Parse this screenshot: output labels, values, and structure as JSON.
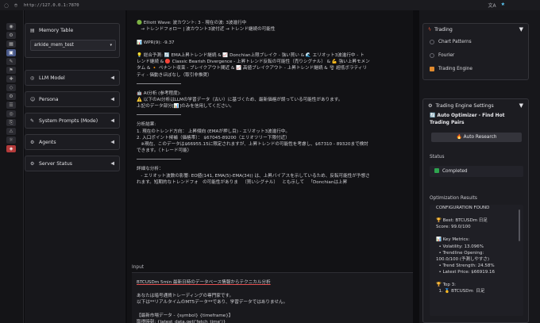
{
  "browser": {
    "url": "http://127.0.0.1:7870",
    "translate_icon": "文A",
    "star_icon": "★"
  },
  "nav_icons": [
    "◉",
    "⚙",
    "▦",
    "▣",
    "✎",
    "⚑",
    "✚",
    "◇",
    "⚙",
    "☰",
    "◎",
    "⎘",
    "⚠",
    "☼",
    "◈"
  ],
  "sidebar": {
    "memory_table": {
      "label": "Memory Table",
      "value": "arkide_mem_test"
    },
    "panels": [
      {
        "label": "LLM Model"
      },
      {
        "label": "Persona"
      },
      {
        "label": "System Prompts (Mode)"
      },
      {
        "label": "Agents"
      },
      {
        "label": "Server Status"
      }
    ]
  },
  "output": {
    "lines": [
      "🟢 Elliott Wave: 波カウント: 3 - 現在の波: 3波進行中",
      "   → トレンドフォロー | 波カウント3波付近 → トレンド継続の可能性",
      "",
      "📊 WPR(9): -9.37",
      "",
      "💡 総合予測: 🔄 EMA上昇トレンド継続 & 📈 Donchian上限ブレイク - 強い買い & 🌊 エリオット3波進行中 - ト",
      "レンド継続 & 🔴 Classic Bearish Divergence - 上昇トレンド反転の可能性（売りシグナル） & 💪 強い上昇モメン",
      "タム & 🔸 ペナント収束 - ブレイクアウト間近 & 📈 高値ブレイクアウト - 上昇トレンド継続 & 🌪 超低ボラティリ",
      "ティ - 価動きほぼなし（取引非推奨）"
    ],
    "ai_lines": [
      "🤖 AI分析 (参考程度):",
      "⚠️ 以下のAI分析はLLMの学習データ（古い）に基づくため、最新価格が誤っている可能性があります。",
      "上記のデータ部分[📊]のみを信用してください。"
    ],
    "analysis_lines": [
      "分析結果:",
      "1. 現在のトレンド方向： 上昇傾向 (EMAが押し目) - エリオット3波進行中。",
      "2. 入口ポイント候補（価格帯）： $67045-89200（エリオツリー下限付近）",
      "   ※現在、このデータは$66955.15に限定されますが、上昇トレンドの可能性を考慮し、$67310 - 89320まで検討",
      "できます。（トレード可能）"
    ],
    "detail_lines": [
      "詳細な分析：",
      "   - エリオット波数の影響: EO値(141, EMA(5)-EMA(34)) は、上昇バイアスを示しているため、反転可能性が予想さ",
      "れます。短期的なトレンドフォ   の可能性がありま   （買いシグナル）   とも示して   「Donchianは上昇"
    ]
  },
  "input": {
    "label": "Input",
    "lines": [
      "BTCUSDm 5min 最新日時のデータベース情報からテクニカル分析",
      "",
      "あなたは暗号通貨トレーディングの専門家です。",
      "以下は**リアルタイムのMT5データ**であり、学習データではありません。",
      "",
      "【最新市場データ - {symbol} {timeframe}】",
      "取得時刻: {latest_data.get('fetch_time')}"
    ]
  },
  "right": {
    "trading": {
      "title": "Trading",
      "options": [
        {
          "label": "Chart Patterns",
          "checked": false
        },
        {
          "label": "Fourier",
          "checked": false
        },
        {
          "label": "Trading Engine",
          "checked": true
        }
      ]
    },
    "settings": {
      "title": "Trading Engine Settings",
      "subtitle": "🔄 Auto Optimizer - Find Hot Trading Pairs",
      "button": "🔥 Auto Research",
      "status_label": "Status",
      "status_value": "Completed",
      "results_label": "Optimization Results",
      "results_lines": [
        "CONFIGURATION FOUND",
        "",
        "🏆 Best: BTCUSDm 日足",
        "Score: 99.0/100",
        "",
        "📊 Key Metrics:",
        "  • Volatility: 13.096%",
        "  • Trendline Opening:",
        "100.0/100 (予測しやすさ)",
        "  • Trend Strength: 24.58%",
        "  • Latest Price: $66919.16",
        "",
        "🏆 Top 3:",
        "  1. 🥇 BTCUSDm  日足"
      ]
    }
  }
}
